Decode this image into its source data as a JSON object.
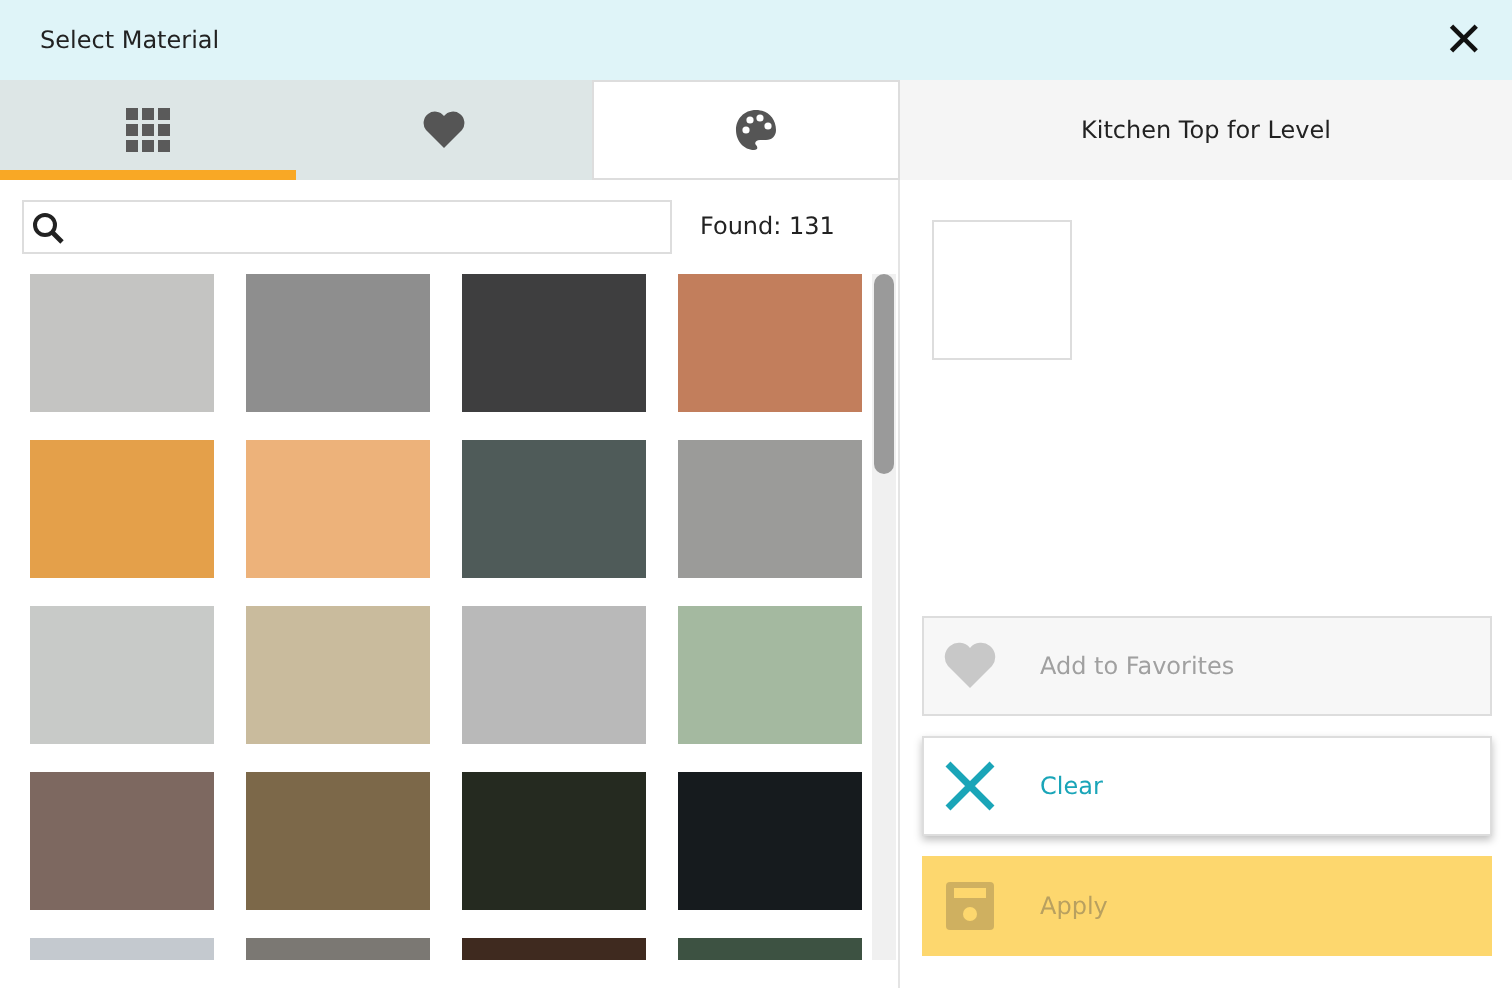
{
  "window": {
    "title": "Select Material",
    "close": "✕"
  },
  "tabs": [
    {
      "kind": "grid",
      "selected": true,
      "active": false
    },
    {
      "kind": "heart",
      "selected": false,
      "active": false
    },
    {
      "kind": "palette",
      "selected": false,
      "active": true
    }
  ],
  "search": {
    "found": "Found: 131"
  },
  "swatches": [
    {
      "color": "#c4c4c2"
    },
    {
      "color": "#8e8e8e"
    },
    {
      "color": "#3e3e3f"
    },
    {
      "color": "#c27e5c"
    },
    {
      "color": "#e4a04a"
    },
    {
      "color": "#edb27a"
    },
    {
      "color": "#4f5b59"
    },
    {
      "color": "#9b9b99"
    },
    {
      "color": "#c8cac8"
    },
    {
      "color": "#c9bb9d"
    },
    {
      "color": "#b9b9b9"
    },
    {
      "color": "#a4b9a0"
    },
    {
      "color": "#7d6860"
    },
    {
      "color": "#7c6849"
    },
    {
      "color": "#252a20"
    },
    {
      "color": "#161b1e"
    },
    {
      "color": "#c4c9cf"
    },
    {
      "color": "#7b7873"
    },
    {
      "color": "#3f2a1f"
    },
    {
      "color": "#3d5242"
    }
  ],
  "panel": {
    "title": "Kitchen Top for Level"
  },
  "actions": [
    {
      "kind": "favorite",
      "label": "Add to Favorites",
      "disabled": true
    },
    {
      "kind": "clear",
      "label": "Clear",
      "disabled": false
    },
    {
      "kind": "apply",
      "label": "Apply",
      "disabled": true
    }
  ]
}
